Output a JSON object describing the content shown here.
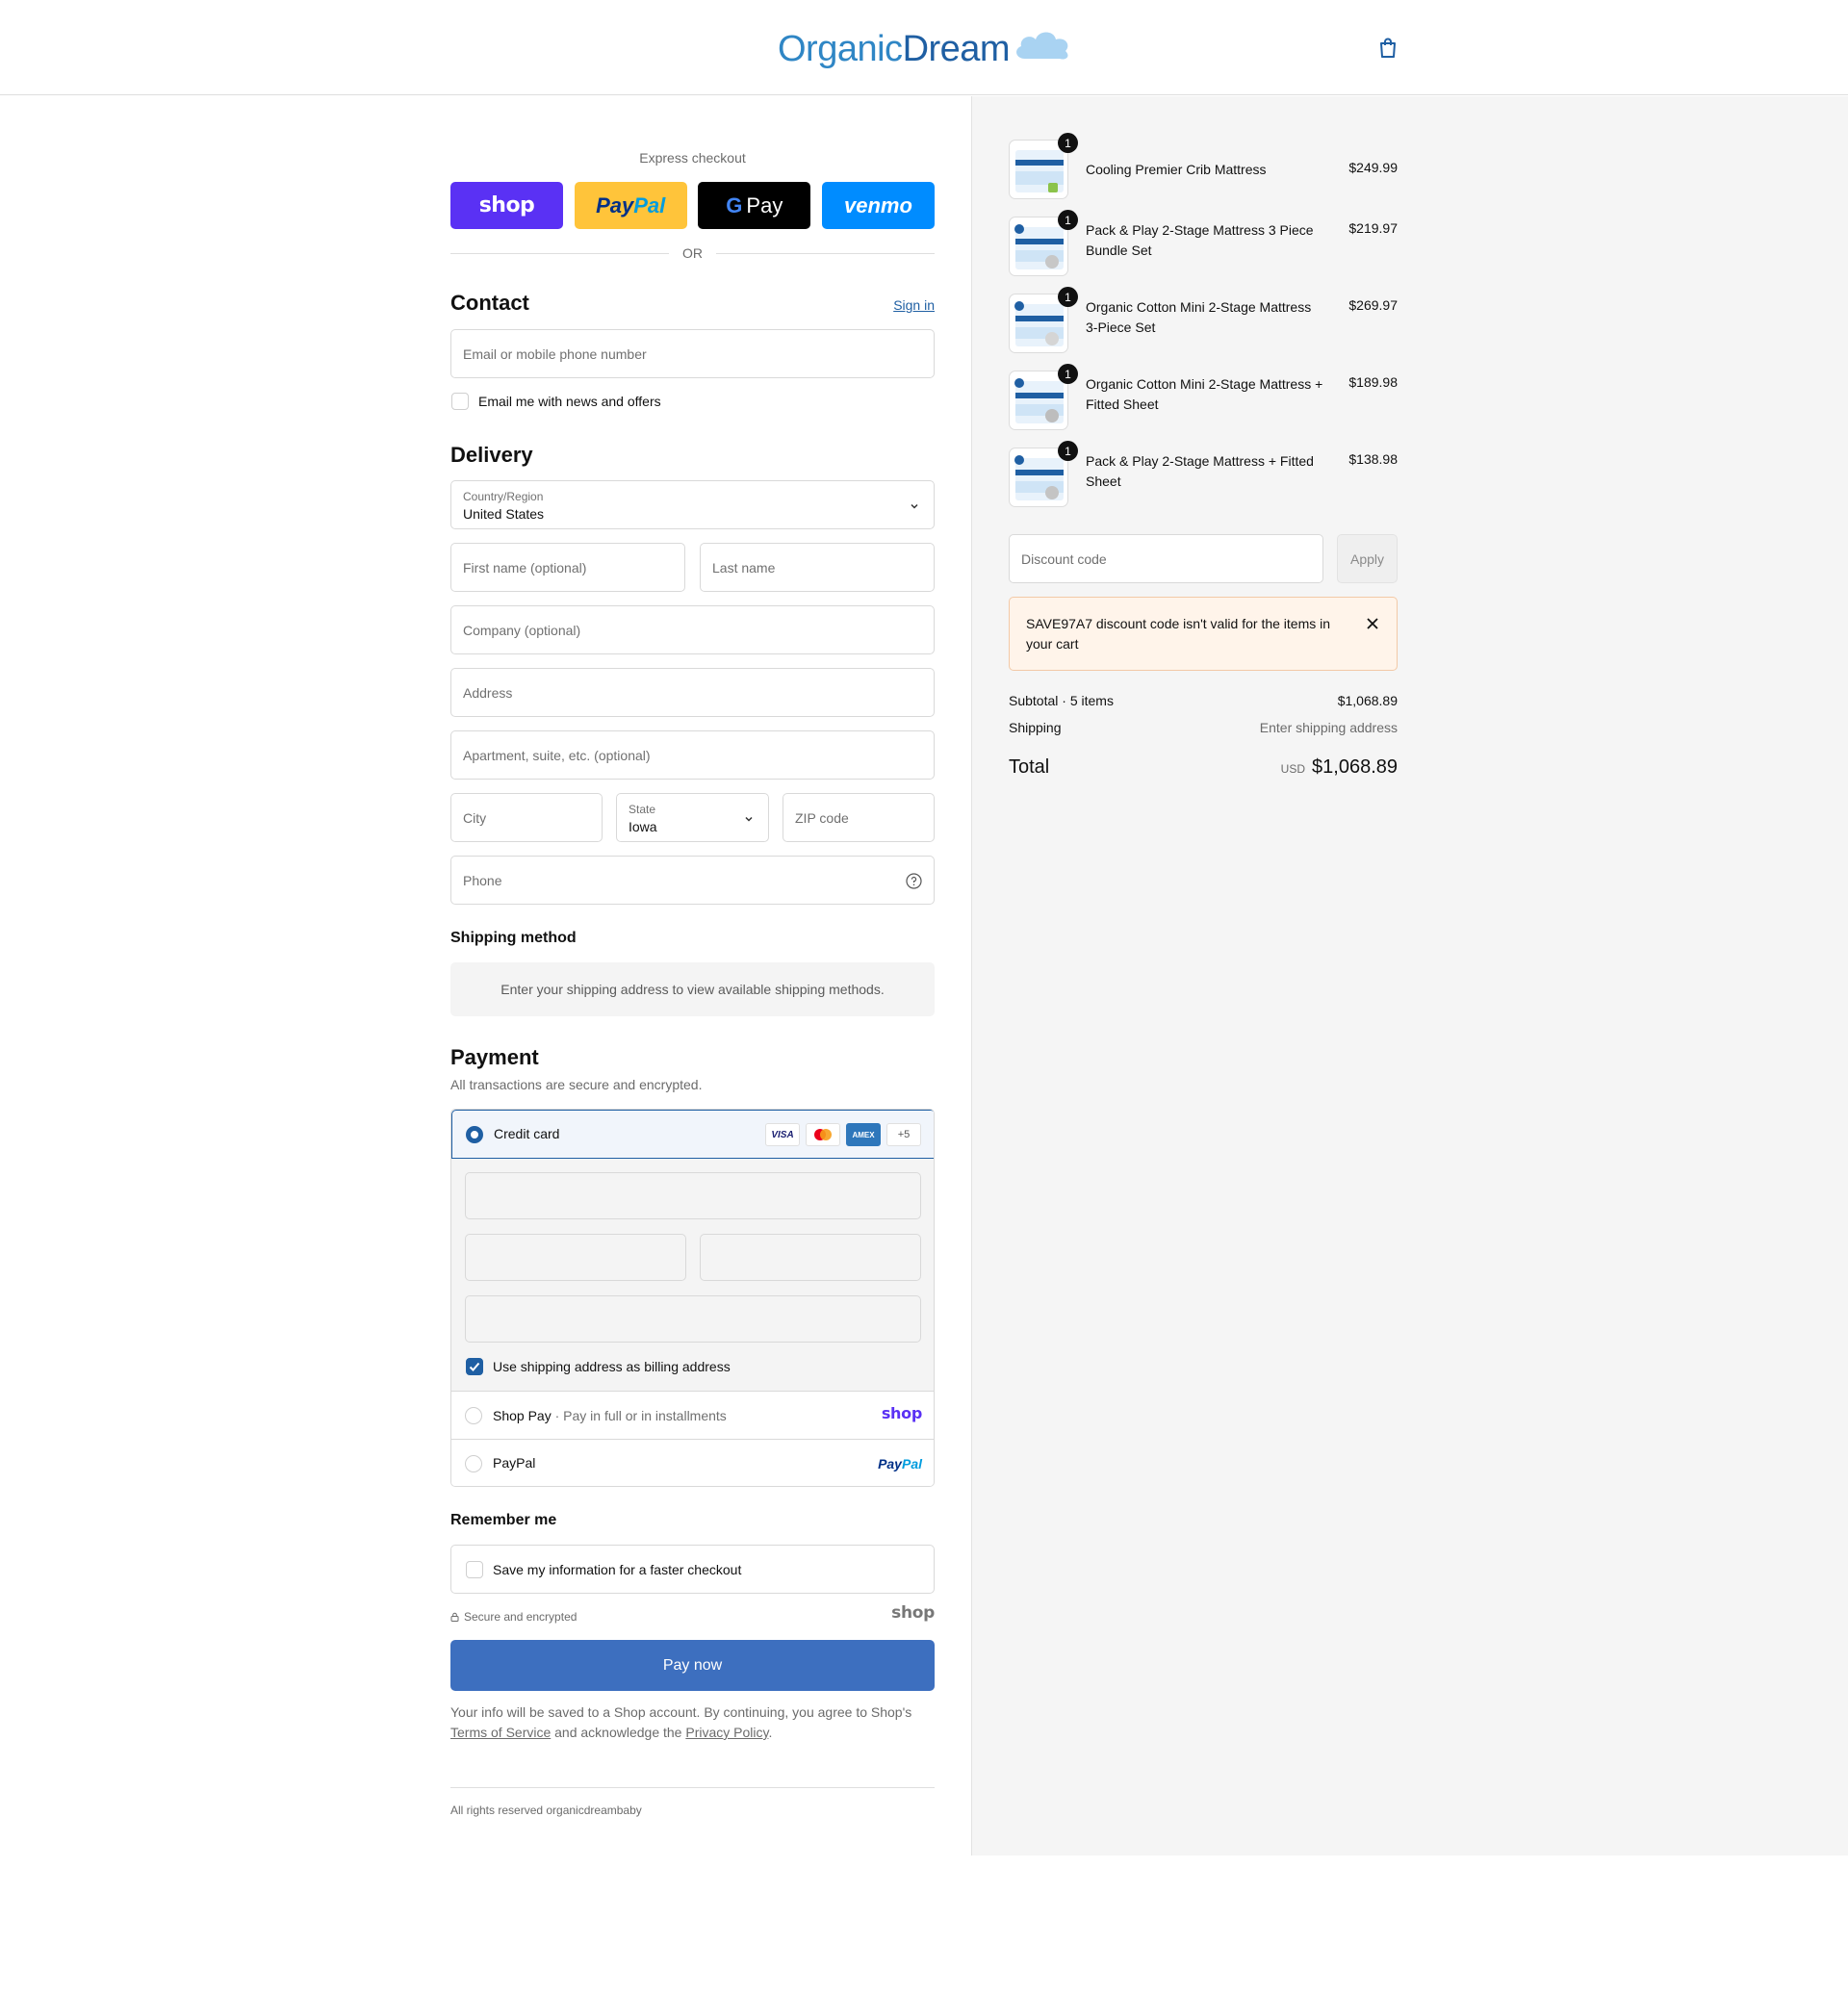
{
  "brand": {
    "name_part1": "Organic",
    "name_part2": "Dream",
    "colors": {
      "primary": "#1f5fa3",
      "accent": "#2f86c5",
      "pay_button": "#3d6fbf"
    }
  },
  "header": {
    "cart_icon": "shopping-bag-icon"
  },
  "express": {
    "title": "Express checkout",
    "shop_label": "shop",
    "paypal_part1": "Pay",
    "paypal_part2": "Pal",
    "gpay_g": "G",
    "gpay_label": "Pay",
    "venmo_label": "venmo",
    "or_label": "OR"
  },
  "contact": {
    "title": "Contact",
    "sign_in": "Sign in",
    "email_placeholder": "Email or mobile phone number",
    "newsletter_label": "Email me with news and offers",
    "newsletter_checked": false
  },
  "delivery": {
    "title": "Delivery",
    "country_label": "Country/Region",
    "country_value": "United States",
    "first_name_placeholder": "First name (optional)",
    "last_name_placeholder": "Last name",
    "company_placeholder": "Company (optional)",
    "address_placeholder": "Address",
    "apartment_placeholder": "Apartment, suite, etc. (optional)",
    "city_placeholder": "City",
    "state_label": "State",
    "state_value": "Iowa",
    "zip_placeholder": "ZIP code",
    "phone_placeholder": "Phone"
  },
  "shipping_method": {
    "title": "Shipping method",
    "message": "Enter your shipping address to view available shipping methods."
  },
  "payment": {
    "title": "Payment",
    "subtitle": "All transactions are secure and encrypted.",
    "credit_card_label": "Credit card",
    "card_visa": "VISA",
    "card_amex": "AMEX",
    "card_more": "+5",
    "billing_label": "Use shipping address as billing address",
    "billing_checked": true,
    "shoppay_label": "Shop Pay",
    "shoppay_sub": "Pay in full or in installments",
    "shoppay_brand": "shop",
    "paypal_label": "PayPal",
    "paypal_brand_part1": "Pay",
    "paypal_brand_part2": "Pal"
  },
  "remember": {
    "title": "Remember me",
    "save_label": "Save my information for a faster checkout",
    "secure_label": "Secure and encrypted",
    "shop_brand": "shop"
  },
  "actions": {
    "pay_now": "Pay now"
  },
  "terms": {
    "prefix": "Your info will be saved to a Shop account. By continuing, you agree to Shop's",
    "tos": "Terms of Service",
    "middle": "and acknowledge the",
    "privacy": "Privacy Policy",
    "suffix": "."
  },
  "footer": {
    "text": "All rights reserved organicdreambaby"
  },
  "cart": {
    "items": [
      {
        "name": "Cooling Premier Crib Mattress",
        "price": "$249.99",
        "qty": "1"
      },
      {
        "name": "Pack & Play 2-Stage Mattress 3 Piece Bundle Set",
        "price": "$219.97",
        "qty": "1"
      },
      {
        "name": "Organic Cotton Mini 2-Stage Mattress 3-Piece Set",
        "price": "$269.97",
        "qty": "1"
      },
      {
        "name": "Organic Cotton Mini 2-Stage Mattress + Fitted Sheet",
        "price": "$189.98",
        "qty": "1"
      },
      {
        "name": "Pack & Play 2-Stage Mattress + Fitted Sheet",
        "price": "$138.98",
        "qty": "1"
      }
    ],
    "discount_placeholder": "Discount code",
    "apply_label": "Apply",
    "alert_message": "SAVE97A7 discount code isn't valid for the items in your cart",
    "subtotal_label": "Subtotal · 5 items",
    "subtotal_value": "$1,068.89",
    "shipping_label": "Shipping",
    "shipping_value": "Enter shipping address",
    "total_label": "Total",
    "total_currency": "USD",
    "total_value": "$1,068.89"
  }
}
